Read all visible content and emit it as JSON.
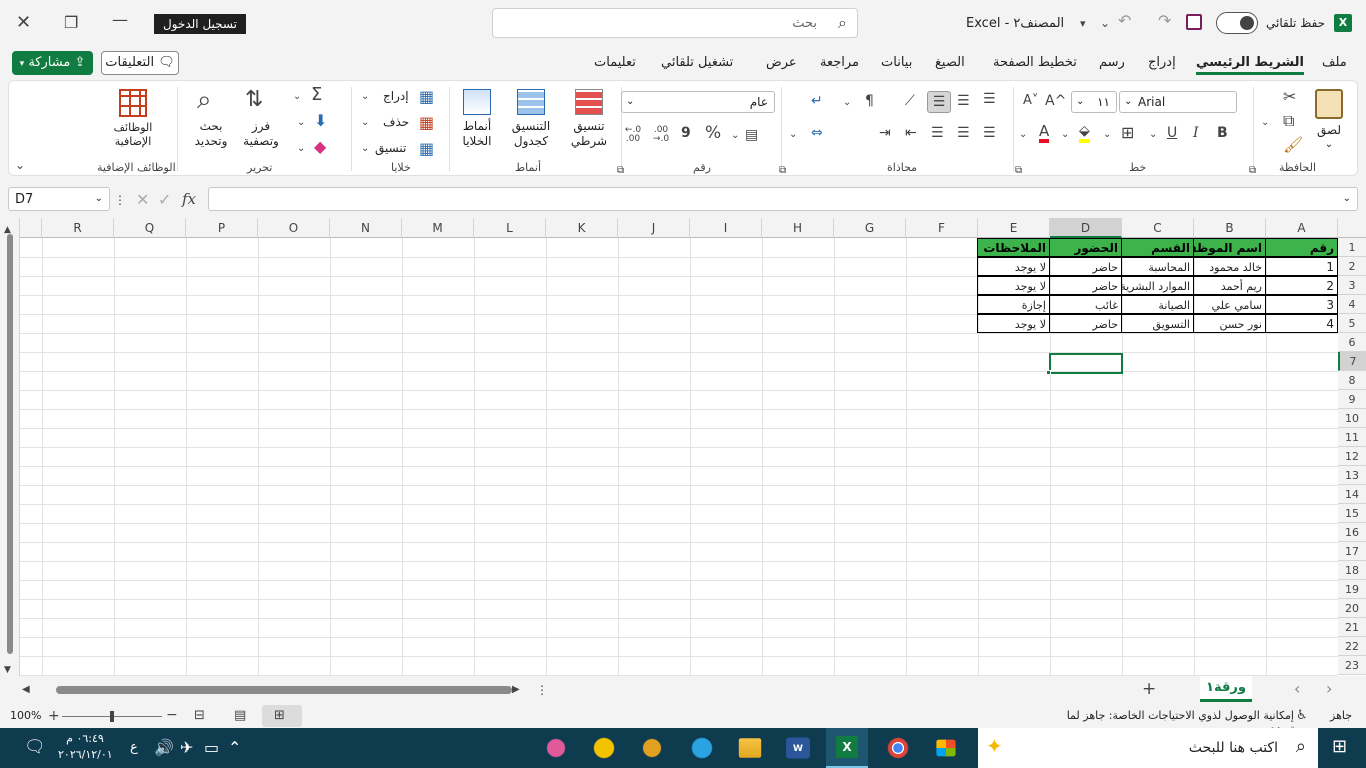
{
  "titlebar": {
    "autosave_label": "حفظ تلقائي",
    "doc_title": "المصنف٢",
    "app_name": "Excel",
    "title_separator": "-",
    "search_placeholder": "بحث",
    "signin_label": "تسجيل الدخول"
  },
  "tabs": [
    "ملف",
    "الشريط الرئيسي",
    "إدراج",
    "رسم",
    "تخطيط الصفحة",
    "الصيغ",
    "بيانات",
    "مراجعة",
    "عرض",
    "تشغيل تلقائي",
    "تعليمات"
  ],
  "tabs_active": "الشريط الرئيسي",
  "comments_label": "التعليقات",
  "share_label": "مشاركة",
  "ribbon": {
    "clipboard": {
      "paste": "لصق",
      "group": "الحافظة"
    },
    "font": {
      "name": "Arial",
      "size": "١١",
      "bold": "B",
      "italic": "I",
      "underline": "U",
      "grow": "A^",
      "shrink": "A˅",
      "group": "خط"
    },
    "alignment": {
      "group": "محاذاة"
    },
    "number": {
      "format": "عام",
      "percent": "%",
      "comma": "9",
      "inc_decimal": "←.0 .00",
      "dec_decimal": ".00 →.0",
      "group": "رقم"
    },
    "styles": {
      "conditional": "تنسيق\nشرطي",
      "table": "التنسيق\nكجدول",
      "cell": "أنماط\nالخلايا",
      "group": "أنماط"
    },
    "cells": {
      "insert": "إدراج",
      "delete": "حذف",
      "format": "تنسيق",
      "group": "خلايا"
    },
    "editing": {
      "sort": "فرز\nوتصفية",
      "find": "بحث\nوتحديد",
      "group": "تحرير"
    },
    "addins": {
      "label": "الوظائف\nالإضافية",
      "group": "الوظائف الإضافية"
    }
  },
  "formula_bar": {
    "name_box": "D7",
    "fx": "fx",
    "value": ""
  },
  "columns": [
    "A",
    "B",
    "C",
    "D",
    "E",
    "F",
    "G",
    "H",
    "I",
    "J",
    "K",
    "L",
    "M",
    "N",
    "O",
    "P",
    "Q",
    "R"
  ],
  "rows": [
    "1",
    "2",
    "3",
    "4",
    "5",
    "6",
    "7",
    "8",
    "9",
    "10",
    "11",
    "12",
    "13",
    "14",
    "15",
    "16",
    "17",
    "18",
    "19",
    "20",
    "21",
    "22",
    "23"
  ],
  "table": {
    "headers": [
      "رقم",
      "اسم الموظف",
      "القسم",
      "الحضور",
      "الملاحظات"
    ],
    "rows": [
      [
        "1",
        "خالد محمود",
        "المحاسبة",
        "حاضر",
        "لا يوجد"
      ],
      [
        "2",
        "ريم أحمد",
        "الموارد البشرية",
        "حاضر",
        "لا يوجد"
      ],
      [
        "3",
        "سامي علي",
        "الصيانة",
        "غائب",
        "إجازة"
      ],
      [
        "4",
        "نور حسن",
        "التسويق",
        "حاضر",
        "لا يوجد"
      ]
    ]
  },
  "sheet_tab": "ورقة١",
  "status": {
    "ready": "جاهز",
    "accessibility": "إمكانية الوصول لذوي الاحتياجات الخاصة: جاهز لما تريده",
    "zoom": "100%"
  },
  "taskbar": {
    "search_placeholder": "اكتب هنا للبحث",
    "time": "٠٦:٤٩ م",
    "date": "٢٠٢٦/١٢/٠١",
    "lang": "ع"
  },
  "colors": {
    "accent": "#107c41",
    "header_fill": "#3cb44b",
    "taskbar": "#0f3b4f"
  }
}
